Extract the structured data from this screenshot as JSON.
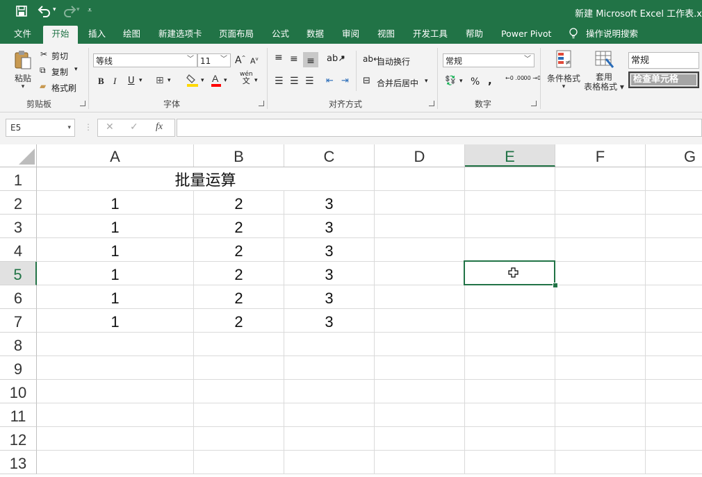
{
  "window": {
    "title": "新建 Microsoft Excel 工作表.x"
  },
  "quick_access": {
    "save_icon": "save-icon",
    "undo_icon": "undo-icon",
    "redo_icon": "redo-icon",
    "customize_icon": "customize-qat-icon"
  },
  "tabs": [
    {
      "label": "文件"
    },
    {
      "label": "开始"
    },
    {
      "label": "插入"
    },
    {
      "label": "绘图"
    },
    {
      "label": "新建选项卡"
    },
    {
      "label": "页面布局"
    },
    {
      "label": "公式"
    },
    {
      "label": "数据"
    },
    {
      "label": "审阅"
    },
    {
      "label": "视图"
    },
    {
      "label": "开发工具"
    },
    {
      "label": "帮助"
    },
    {
      "label": "Power Pivot"
    },
    {
      "label": "操作说明搜索"
    }
  ],
  "ribbon": {
    "clipboard": {
      "paste": "粘贴",
      "cut": "剪切",
      "copy": "复制",
      "format_painter": "格式刷",
      "group": "剪贴板"
    },
    "font": {
      "name": "等线",
      "size": "11",
      "group": "字体",
      "grow": "A",
      "shrink": "A",
      "bold": "B",
      "italic": "I",
      "underline": "U",
      "wen": "wén",
      "wen_char": "文"
    },
    "alignment": {
      "wrap": "自动换行",
      "merge": "合并后居中",
      "group": "对齐方式"
    },
    "number": {
      "format": "常规",
      "percent": "%",
      "comma": ",",
      "inc_decimal": "←0 .00",
      "dec_decimal": ".00 →0",
      "group": "数字"
    },
    "styles": {
      "conditional": "条件格式",
      "table_format_1": "套用",
      "table_format_2": "表格格式",
      "style_normal": "常规",
      "style_check": "检查单元格"
    }
  },
  "formula_bar": {
    "name_box": "E5",
    "cancel": "✕",
    "enter": "✓",
    "fx": "fx",
    "value": ""
  },
  "sheet": {
    "columns": [
      "A",
      "B",
      "C",
      "D",
      "E",
      "F",
      "G"
    ],
    "rows": [
      "1",
      "2",
      "3",
      "4",
      "5",
      "6",
      "7",
      "8",
      "9",
      "10",
      "11",
      "12",
      "13"
    ],
    "title": "批量运算",
    "data": [
      [
        "1",
        "2",
        "3"
      ],
      [
        "1",
        "2",
        "3"
      ],
      [
        "1",
        "2",
        "3"
      ],
      [
        "1",
        "2",
        "3"
      ],
      [
        "1",
        "2",
        "3"
      ],
      [
        "1",
        "2",
        "3"
      ]
    ],
    "active_cell": "E5",
    "accent": "#217346"
  }
}
